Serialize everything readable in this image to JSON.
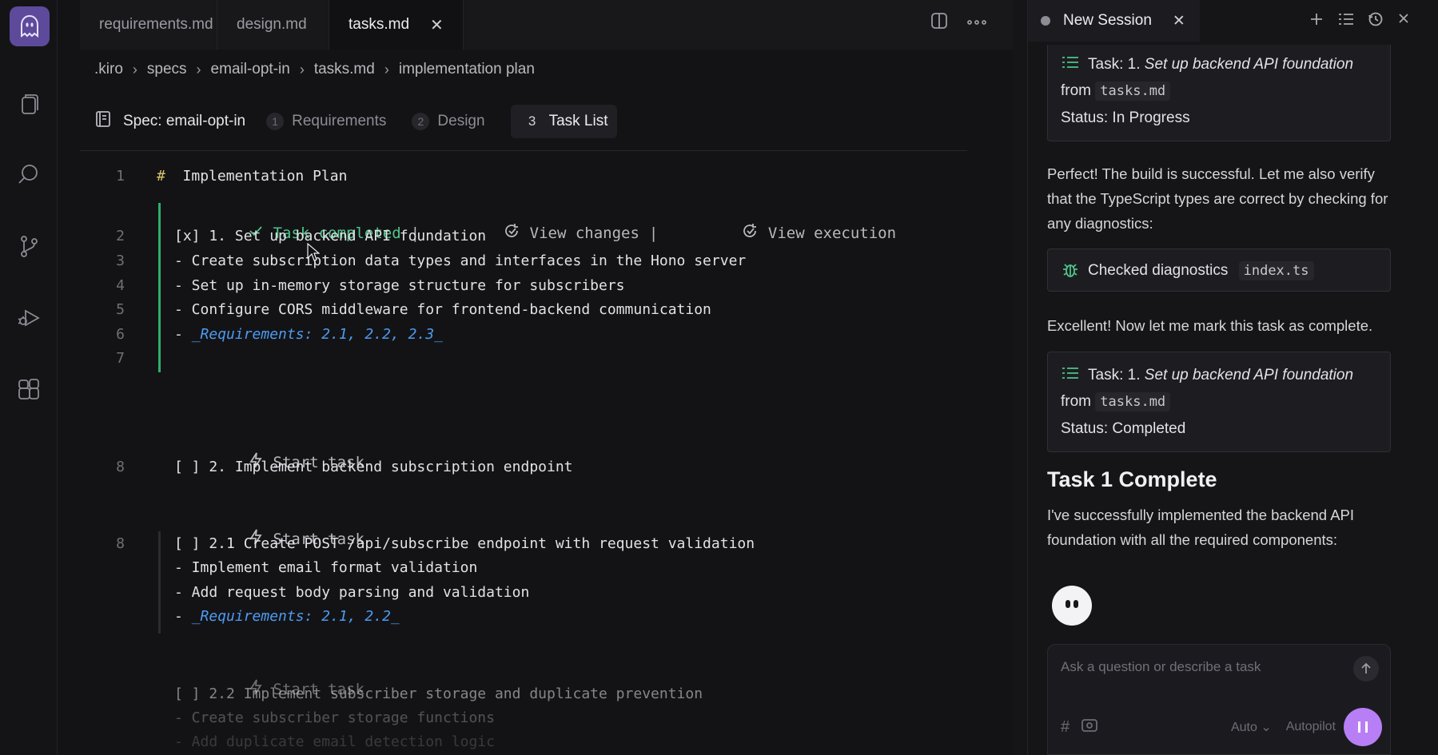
{
  "editor": {
    "tabs": [
      {
        "label": "requirements.md"
      },
      {
        "label": "design.md"
      },
      {
        "label": "tasks.md"
      }
    ],
    "close_glyph": "✕",
    "breadcrumb": [
      ".kiro",
      "specs",
      "email-opt-in",
      "tasks.md",
      "implementation plan"
    ],
    "spec": {
      "title": "Spec: email-opt-in",
      "steps": [
        {
          "num": "1",
          "label": "Requirements"
        },
        {
          "num": "2",
          "label": "Design"
        },
        {
          "num": "3",
          "label": "Task List"
        }
      ]
    },
    "code": {
      "heading_hash": "#",
      "heading_text": "Implementation Plan",
      "heading_line": "1",
      "task_completed": "Task completed",
      "separator": "|",
      "view_changes": "View changes",
      "view_execution": "View execution",
      "start_task": "Start task",
      "lines": [
        {
          "n": "2",
          "text": "[x] 1. Set up backend API foundation"
        },
        {
          "n": "3",
          "text": "- Create subscription data types and interfaces in the Hono server"
        },
        {
          "n": "4",
          "text": "- Set up in-memory storage structure for subscribers"
        },
        {
          "n": "5",
          "text": "- Configure CORS middleware for frontend-backend communication"
        },
        {
          "n": "6",
          "prefix": "- ",
          "req": "_Requirements: 2.1, 2.2, 2.3_"
        },
        {
          "n": "7",
          "text": ""
        },
        {
          "n": "8",
          "text": "[ ] 2. Implement backend subscription endpoint"
        },
        {
          "n": "8",
          "text": "[ ] 2.1 Create POST /api/subscribe endpoint with request validation"
        },
        {
          "n": "",
          "text": "- Implement email format validation"
        },
        {
          "n": "",
          "text": "- Add request body parsing and validation"
        },
        {
          "n": "",
          "prefix": "- ",
          "req": "_Requirements: 2.1, 2.2_"
        },
        {
          "n": "",
          "text": "[ ] 2.2 Implement subscriber storage and duplicate prevention"
        },
        {
          "n": "",
          "text": "- Create subscriber storage functions"
        },
        {
          "n": "",
          "text": "- Add duplicate email detection logic"
        }
      ]
    }
  },
  "chat": {
    "session_title": "New Session",
    "card1": {
      "prefix": "Task: 1.",
      "title": "Set up backend API foundation",
      "from": "from",
      "file": "tasks.md",
      "status": "Status: In Progress"
    },
    "para1": "Perfect! The build is successful. Let me also verify that the TypeScript types are correct by checking for any diagnostics:",
    "diag": {
      "label": "Checked diagnostics",
      "file": "index.ts"
    },
    "para2": "Excellent! Now let me mark this task as complete.",
    "card2": {
      "prefix": "Task: 1.",
      "title": "Set up backend API foundation",
      "from": "from",
      "file": "tasks.md",
      "status": "Status: Completed"
    },
    "heading": "Task 1 Complete",
    "para3": "I've successfully implemented the backend API foundation with all the required components:",
    "input": {
      "placeholder": "Ask a question or describe a task",
      "mode": "Auto",
      "autopilot": "Autopilot",
      "hash": "#"
    }
  },
  "colors": {
    "accent": "#b77ef5",
    "success": "#4fc38a",
    "link": "#4d9bf0",
    "logo_bg": "#5d4a9a"
  }
}
